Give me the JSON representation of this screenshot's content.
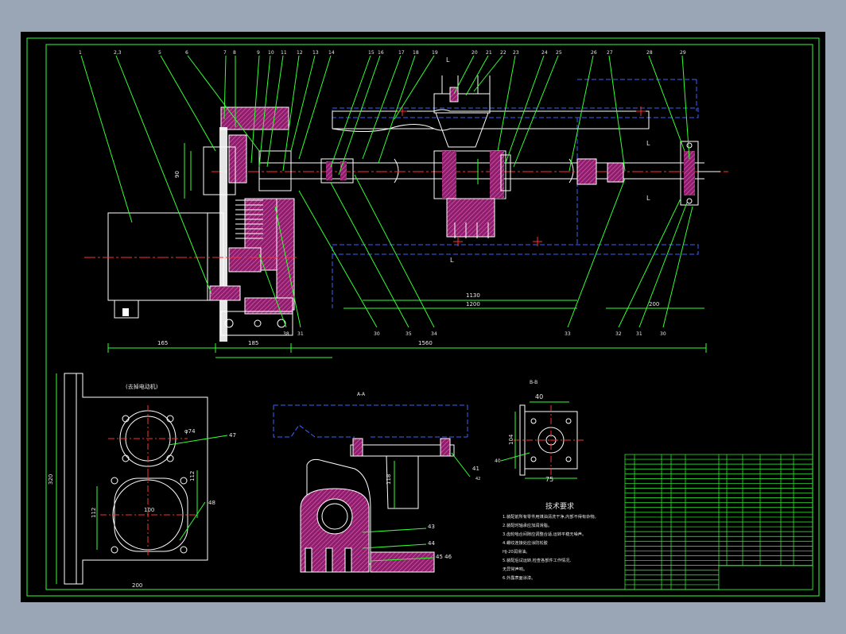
{
  "balloons_top": [
    "1",
    "2,3",
    "5",
    "6",
    "7",
    "8",
    "9",
    "10",
    "11",
    "12",
    "13",
    "14",
    "15",
    "16",
    "17",
    "18",
    "19",
    "20",
    "21",
    "22",
    "23",
    "24",
    "25",
    "26",
    "27",
    "28",
    "29"
  ],
  "balloons_bottom": [
    "38",
    "31",
    "30",
    "35",
    "34",
    "33",
    "32",
    "31",
    "30"
  ],
  "dims": {
    "overall": "1560",
    "motor_len": "165",
    "box_len": "185",
    "span_1130": "1130",
    "span_1200": "1200",
    "span_200": "200",
    "view_width": "200",
    "view_height": "320",
    "dia_74": "φ74",
    "d112": "112",
    "d112b": "112",
    "d100": "100",
    "d90": "90",
    "d118": "118",
    "d40": "40",
    "d75": "75",
    "d104": "104",
    "d48": "48",
    "d47": "47",
    "d40b": "40",
    "d41": "41"
  },
  "views": {
    "motor_view_title": "(去掉电动机)",
    "section_aa": "A-A",
    "section_bb": "B-B",
    "section_cc": "C-C",
    "section_marks": [
      "L",
      "L",
      "L",
      "L"
    ]
  },
  "labels_section": [
    "43",
    "44",
    "45 46",
    "41",
    "42"
  ],
  "tech": {
    "title": "技术要求",
    "lines": [
      "1.装配前所有零件用煤油清洗干净,内部不得有杂物。",
      "2.装配时轴承应加润滑脂。",
      "3.齿轮啮合间隙应调整合适,运转平稳无噪声。",
      "4.螺纹连接处应涂防松胶",
      "HJ-20润滑油。",
      "5.装配后试运转,检查各部件工作情况,",
      "无异常声响。",
      "6.外露表面涂漆。"
    ]
  },
  "colors": {
    "sheet": "#000000",
    "frame": "#33ff33",
    "part": "#ffffff",
    "hatch": "#d040a0",
    "leader": "#33ff33",
    "center": "#ff3030",
    "hidden": "#4060ff"
  }
}
